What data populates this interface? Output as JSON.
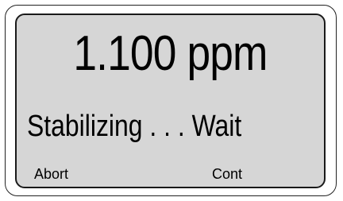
{
  "display": {
    "reading_value": "1.100",
    "reading_unit": "ppm",
    "reading_text": "1.100 ppm",
    "status_text": "Stabilizing . . . Wait"
  },
  "softkeys": {
    "left_label": "Abort",
    "right_label": "Cont"
  },
  "colors": {
    "screen_background": "#d6d6d6",
    "text": "#000000",
    "frame_border": "#222222"
  }
}
